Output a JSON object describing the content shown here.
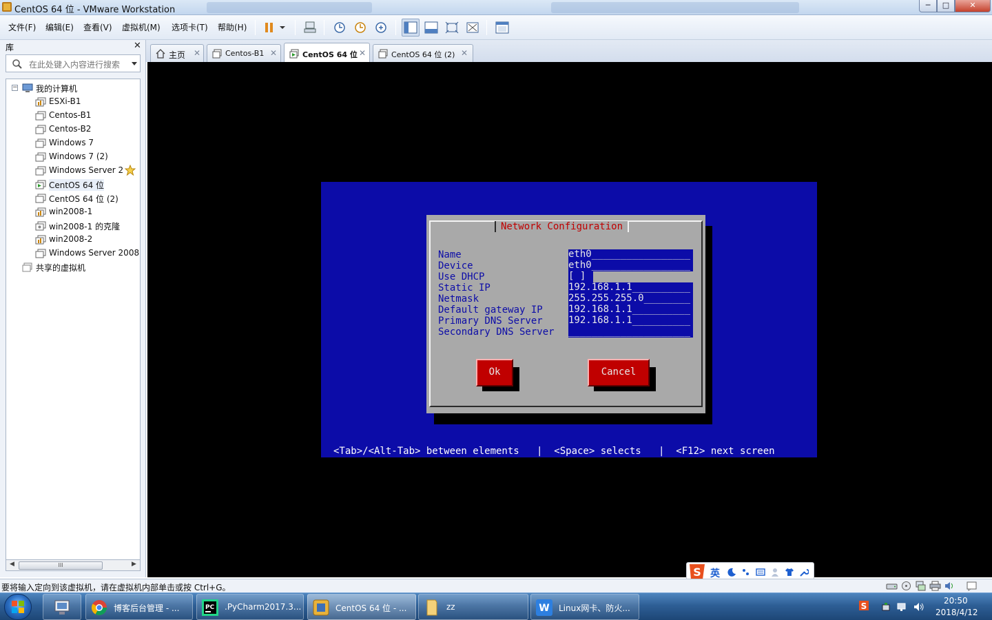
{
  "window": {
    "title": "CentOS 64 位 - VMware Workstation",
    "controls": {
      "min": "─",
      "max": "□",
      "close": "✕"
    }
  },
  "menu": [
    "文件(F)",
    "编辑(E)",
    "查看(V)",
    "虚拟机(M)",
    "选项卡(T)",
    "帮助(H)"
  ],
  "library": {
    "title": "库",
    "close": "✕",
    "search_placeholder": "在此处键入内容进行搜索",
    "tree": {
      "root": "我的计算机",
      "items": [
        "ESXi-B1",
        "Centos-B1",
        "Centos-B2",
        "Windows 7",
        "Windows 7 (2)",
        "Windows Server 2",
        "CentOS 64 位",
        "CentOS 64 位 (2)",
        "win2008-1",
        "win2008-1 的克隆",
        "win2008-2",
        "Windows Server 2008"
      ],
      "selected": "CentOS 64 位",
      "shared": "共享的虚拟机"
    },
    "scroll_thumb": "III"
  },
  "tabs": [
    {
      "label": "主页",
      "icon": "home-icon"
    },
    {
      "label": "Centos-B1",
      "icon": "vm-icon"
    },
    {
      "label": "CentOS 64 位",
      "icon": "vm-running-icon",
      "active": true
    },
    {
      "label": "CentOS 64 位 (2)",
      "icon": "vm-icon"
    }
  ],
  "tab_close": "✕",
  "console": {
    "dialog_title": "Network Configuration",
    "fields": [
      {
        "label": "Name",
        "value": "eth0"
      },
      {
        "label": "Device",
        "value": "eth0"
      },
      {
        "label": "Use DHCP",
        "value": "[ ]"
      },
      {
        "label": "Static IP",
        "value": "192.168.1.1"
      },
      {
        "label": "Netmask",
        "value": "255.255.255.0"
      },
      {
        "label": "Default gateway IP",
        "value": "192.168.1.1"
      },
      {
        "label": "Primary DNS Server",
        "value": "192.168.1.1"
      },
      {
        "label": "Secondary DNS Server",
        "value": ""
      }
    ],
    "ok": "Ok",
    "cancel": "Cancel",
    "help": "<Tab>/<Alt-Tab> between elements   |  <Space> selects   |  <F12> next screen"
  },
  "ime": {
    "lang": "英"
  },
  "status": {
    "text": "要将输入定向到该虚拟机，请在虚拟机内部单击或按 Ctrl+G。"
  },
  "taskbar": {
    "items": [
      {
        "label": "博客后台管理 - ...",
        "icon": "chrome-icon"
      },
      {
        "label": ".PyCharm2017.3...",
        "icon": "pycharm-icon"
      },
      {
        "label": "CentOS 64 位 - ...",
        "icon": "vmware-icon",
        "active": true
      },
      {
        "label": "zz",
        "icon": "folder-icon"
      },
      {
        "label": "Linux网卡、防火...",
        "icon": "wps-writer-icon"
      }
    ],
    "clock": {
      "time": "20:50",
      "date": "2018/4/12"
    }
  },
  "colors": {
    "tui_blue": "#0c0ca8",
    "tui_red": "#c00000",
    "dialog_gray": "#a9a9a9"
  }
}
